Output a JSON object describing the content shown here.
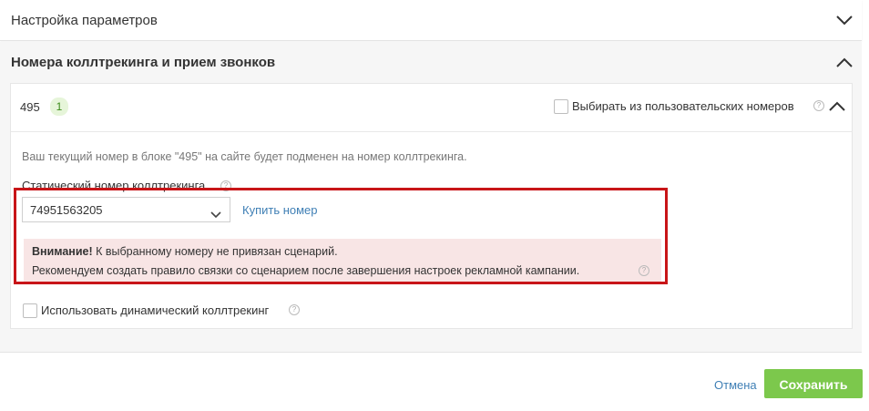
{
  "settings_section": {
    "title": "Настройка параметров"
  },
  "calltracking_section": {
    "title": "Номера коллтрекинга и прием звонков",
    "number_block": {
      "label": "495",
      "count": "1",
      "custom_numbers_label": "Выбирать из пользовательских номеров",
      "info_text": "Ваш текущий номер в блоке \"495\" на сайте будет подменен на номер коллтрекинга.",
      "static_number_label": "Статический номер коллтрекинга",
      "static_number_value": "74951563205",
      "buy_number_link": "Купить номер",
      "warning": {
        "title": "Внимание!",
        "line1": "К выбранному номеру не привязан сценарий.",
        "line2": "Рекомендуем создать правило связки со сценарием после завершения настроек рекламной кампании."
      },
      "dynamic_calltracking_label": "Использовать динамический коллтрекинг"
    }
  },
  "footer": {
    "cancel_label": "Отмена",
    "save_label": "Сохранить"
  },
  "colors": {
    "accent_green": "#7cc84c",
    "link_blue": "#3f7fb5",
    "warning_bg": "#f8e5e5",
    "highlight_red": "#c81518"
  }
}
